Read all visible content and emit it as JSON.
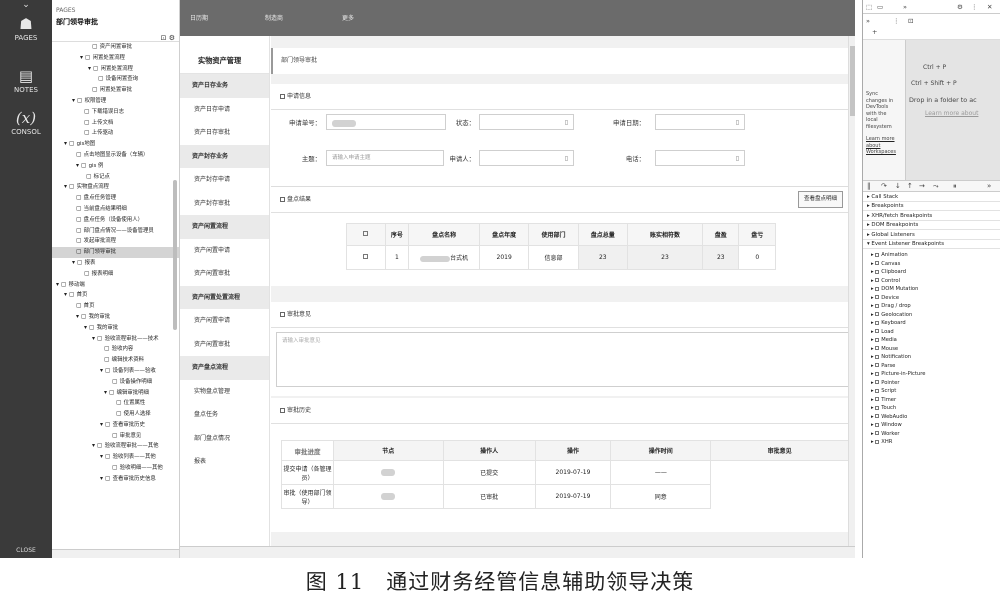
{
  "leftbar": {
    "pages": "PAGES",
    "notes": "NOTES",
    "console": "CONSOL",
    "console_icon": "(x)",
    "close": "CLOSE"
  },
  "tree": {
    "pages_label": "PAGES",
    "title": "部门领导审批",
    "nodes": [
      {
        "indent": 40,
        "label": "资产闲置审批",
        "icon": "▢"
      },
      {
        "indent": 28,
        "label": "闲置处置流程",
        "icon": "▾ ▢"
      },
      {
        "indent": 36,
        "label": "闲置处置流程",
        "icon": "▾ ▢"
      },
      {
        "indent": 46,
        "label": "设备闲置查询",
        "icon": "▢"
      },
      {
        "indent": 40,
        "label": "闲置处置审批",
        "icon": "▢"
      },
      {
        "indent": 20,
        "label": "权限管理",
        "icon": "▾ ▢"
      },
      {
        "indent": 32,
        "label": "下载错误日志",
        "icon": "▢"
      },
      {
        "indent": 32,
        "label": "上传文档",
        "icon": "▢"
      },
      {
        "indent": 32,
        "label": "上传驱动",
        "icon": "▢"
      },
      {
        "indent": 12,
        "label": "gis地图",
        "icon": "▾ ▢"
      },
      {
        "indent": 24,
        "label": "点击地图显示设备（车辆）",
        "icon": "▢"
      },
      {
        "indent": 24,
        "label": "gis 例",
        "icon": "▾ ▢"
      },
      {
        "indent": 34,
        "label": "标记点",
        "icon": "▢"
      },
      {
        "indent": 12,
        "label": "实物盘点流程",
        "icon": "▾ ▢"
      },
      {
        "indent": 24,
        "label": "盘点任务管理",
        "icon": "▢"
      },
      {
        "indent": 24,
        "label": "当前盘点结果明细",
        "icon": "▢"
      },
      {
        "indent": 24,
        "label": "盘点任务（设备使用人）",
        "icon": "▢"
      },
      {
        "indent": 24,
        "label": "部门盘点情况——设备管理员",
        "icon": "▢"
      },
      {
        "indent": 24,
        "label": "发起审批流程",
        "icon": "▢"
      },
      {
        "indent": 24,
        "label": "部门领导审批",
        "icon": "▢",
        "selected": true
      },
      {
        "indent": 20,
        "label": "报表",
        "icon": "▾ ▢"
      },
      {
        "indent": 32,
        "label": "报表明细",
        "icon": "▢"
      },
      {
        "indent": 4,
        "label": "移动端",
        "icon": "▾ ▢"
      },
      {
        "indent": 12,
        "label": "首页",
        "icon": "▾ ▢"
      },
      {
        "indent": 24,
        "label": "首页",
        "icon": "▢"
      },
      {
        "indent": 24,
        "label": "我的审批",
        "icon": "▾ ▢"
      },
      {
        "indent": 32,
        "label": "我的审批",
        "icon": "▾ ▢"
      },
      {
        "indent": 40,
        "label": "验收流程审批——技术",
        "icon": "▾ ▢"
      },
      {
        "indent": 52,
        "label": "验收内容",
        "icon": "▢"
      },
      {
        "indent": 52,
        "label": "编辑技术资料",
        "icon": "▢"
      },
      {
        "indent": 48,
        "label": "设备列表——验收",
        "icon": "▾ ▢"
      },
      {
        "indent": 60,
        "label": "设备操作明细",
        "icon": "▢"
      },
      {
        "indent": 52,
        "label": "编辑审批明细",
        "icon": "▾ ▢"
      },
      {
        "indent": 64,
        "label": "位置属性",
        "icon": "▢"
      },
      {
        "indent": 64,
        "label": "使用人选择",
        "icon": "▢"
      },
      {
        "indent": 48,
        "label": "查看审批历史",
        "icon": "▾ ▢"
      },
      {
        "indent": 60,
        "label": "审批意见",
        "icon": "▢"
      },
      {
        "indent": 40,
        "label": "验收流程审批——其他",
        "icon": "▾ ▢"
      },
      {
        "indent": 48,
        "label": "验收列表——其他",
        "icon": "▾ ▢"
      },
      {
        "indent": 60,
        "label": "验收明细——其他",
        "icon": "▢"
      },
      {
        "indent": 48,
        "label": "查看审批历史信息",
        "icon": "▾ ▢"
      }
    ]
  },
  "topnav": {
    "items": [
      "日历期",
      "制造商",
      "更多"
    ]
  },
  "side": {
    "title": "实物资产管理",
    "items": [
      {
        "label": "资产日存业务",
        "group": true
      },
      {
        "label": "资产日存申请",
        "group": false
      },
      {
        "label": "资产日存审批",
        "group": false
      },
      {
        "label": "资产封存业务",
        "group": true
      },
      {
        "label": "资产封存申请",
        "group": false
      },
      {
        "label": "资产封存审批",
        "group": false
      },
      {
        "label": "资产闲置流程",
        "group": true
      },
      {
        "label": "资产闲置申请",
        "group": false
      },
      {
        "label": "资产闲置审批",
        "group": false
      },
      {
        "label": "资产闲置处置流程",
        "group": true
      },
      {
        "label": "资产闲置申请",
        "group": false
      },
      {
        "label": "资产闲置审批",
        "group": false
      },
      {
        "label": "资产盘点流程",
        "group": true
      },
      {
        "label": "实物盘点管理",
        "group": false
      },
      {
        "label": "盘点任务",
        "group": false
      },
      {
        "label": "部门盘点情况",
        "group": false
      },
      {
        "label": "报表",
        "group": false
      }
    ]
  },
  "main": {
    "breadcrumb": "部门领导审批",
    "apply_info": {
      "title": "申请信息",
      "apply_no_label": "申请单号：",
      "status_label": "状态：",
      "apply_date_label": "申请日期：",
      "subject_label": "主题：",
      "subject_placeholder": "请输入申请主题",
      "applicant_label": "申请人：",
      "phone_label": "电话："
    },
    "result": {
      "title": "盘点结果",
      "button": "查看盘点明细",
      "columns": [
        "序号",
        "盘点名称",
        "盘点年度",
        "使用部门",
        "盘点总量",
        "账实相符数",
        "盘盈",
        "盘亏"
      ],
      "rows": [
        {
          "index": "1",
          "name_suffix": "台式机",
          "year": "2019",
          "dept": "信息部",
          "total": "23",
          "match": "23",
          "gain": "23",
          "loss": "0"
        }
      ]
    },
    "opinion": {
      "title": "审批意见",
      "placeholder": "请输入审批意见"
    },
    "history": {
      "title": "审批历史",
      "side_label": "审批进度",
      "columns": [
        "节点",
        "操作人",
        "操作",
        "操作时间",
        "审批意见"
      ],
      "rows": [
        {
          "node": "提交申请（各管理员）",
          "op": "已提交",
          "time": "2019-07-19",
          "opinion": "——"
        },
        {
          "node": "审批（使用部门领导）",
          "op": "已审批",
          "time": "2019-07-19",
          "opinion": "同意"
        }
      ]
    }
  },
  "devtools": {
    "tab_more": "»",
    "shortcut1": "Ctrl + P",
    "shortcut2": "Ctrl + Shift + P",
    "drop_hint": "Drop in a folder to ac",
    "learn_more": "Learn more about",
    "sync_lines": [
      "Sync",
      "changes in",
      "DevTools",
      "with the",
      "local",
      "filesystem"
    ],
    "learn_lines": [
      "Learn more",
      "about",
      "Workspaces"
    ],
    "sections": [
      "Call Stack",
      "Breakpoints",
      "XHR/fetch Breakpoints",
      "DOM Breakpoints",
      "Global Listeners",
      "Event Listener Breakpoints"
    ],
    "events": [
      "Animation",
      "Canvas",
      "Clipboard",
      "Control",
      "DOM Mutation",
      "Device",
      "Drag / drop",
      "Geolocation",
      "Keyboard",
      "Load",
      "Media",
      "Mouse",
      "Notification",
      "Parse",
      "Picture-in-Picture",
      "Pointer",
      "Script",
      "Timer",
      "Touch",
      "WebAudio",
      "Window",
      "Worker",
      "XHR"
    ]
  },
  "caption": "图 11　通过财务经管信息辅助领导决策"
}
